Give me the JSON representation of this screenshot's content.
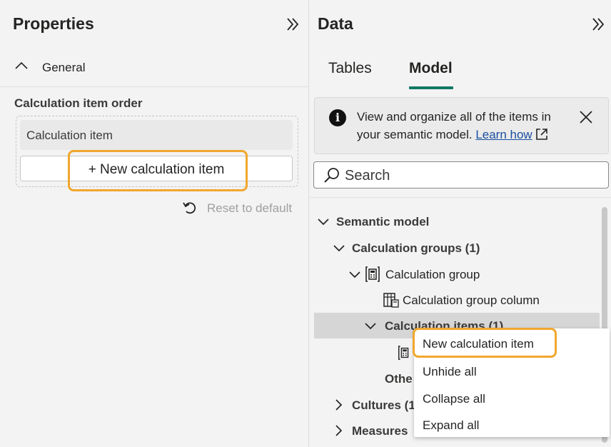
{
  "properties": {
    "title": "Properties",
    "section_label": "General",
    "order_label": "Calculation item order",
    "calc_item_label": "Calculation item",
    "new_button_label": "+ New calculation item",
    "reset_label": "Reset to default"
  },
  "data_pane": {
    "title": "Data",
    "tabs": [
      {
        "label": "Tables",
        "active": false
      },
      {
        "label": "Model",
        "active": true
      }
    ],
    "info": {
      "text": "View and organize all of the items in your semantic model.",
      "link": "Learn how"
    },
    "search": {
      "placeholder": "Search"
    },
    "tree": {
      "semantic_model": "Semantic model",
      "calc_groups": "Calculation groups (1)",
      "calc_group": "Calculation group",
      "calc_group_column": "Calculation group column",
      "calc_items": "Calculation items (1)",
      "other": "Othe",
      "cultures": "Cultures (1",
      "measures": "Measures"
    }
  },
  "context_menu": {
    "items": [
      "New calculation item",
      "Unhide all",
      "Collapse all",
      "Expand all"
    ]
  },
  "colors": {
    "accent": "#117865",
    "highlight": "#f0a72e",
    "link": "#1a4fa0"
  }
}
